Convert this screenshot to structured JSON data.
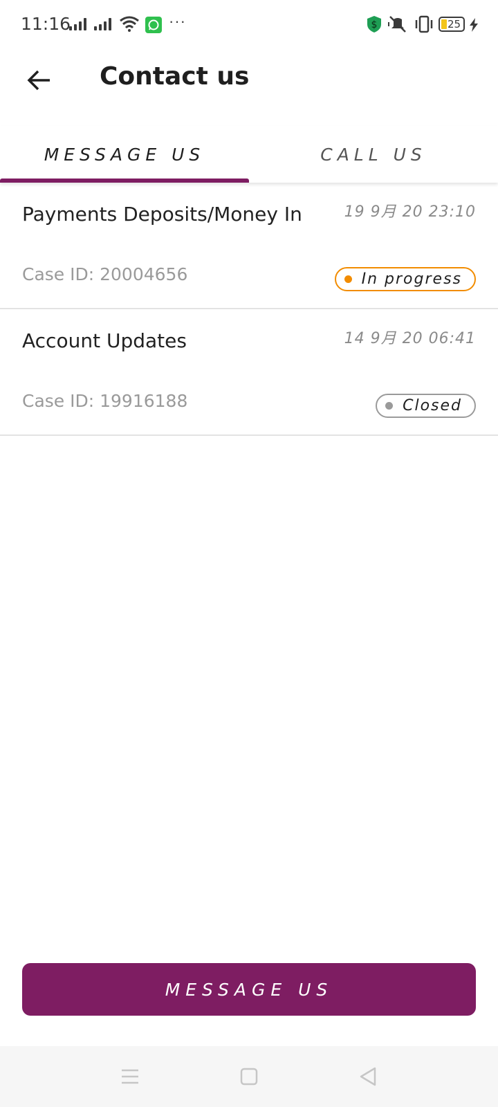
{
  "status_bar": {
    "time": "11:16",
    "battery_level": "25",
    "icons": [
      "signal-icon",
      "signal-icon",
      "wifi-icon",
      "whatsapp-icon",
      "more-dots-icon",
      "shield-dollar-icon",
      "mute-icon",
      "vibrate-icon",
      "battery-icon",
      "charging-icon"
    ],
    "more": "···"
  },
  "header": {
    "title": "Contact us",
    "back_icon": "arrow-left-icon"
  },
  "tabs": [
    {
      "label": "MESSAGE US",
      "active": true
    },
    {
      "label": "CALL US",
      "active": false
    }
  ],
  "cases": [
    {
      "title": "Payments Deposits/Money In",
      "date": "19 9月 20 23:10",
      "case_id": "Case ID: 20004656",
      "status": "In progress",
      "status_color": "#f28c00"
    },
    {
      "title": "Account Updates",
      "date": "14 9月 20 06:41",
      "case_id": "Case ID: 19916188",
      "status": "Closed",
      "status_color": "#9a9a9a"
    }
  ],
  "primary_button": {
    "label": "MESSAGE US"
  },
  "colors": {
    "accent": "#7e1d62",
    "in_progress": "#f28c00",
    "closed": "#9a9a9a"
  },
  "nav_bar": {
    "icons": [
      "menu-icon",
      "home-square-icon",
      "back-triangle-icon"
    ]
  }
}
